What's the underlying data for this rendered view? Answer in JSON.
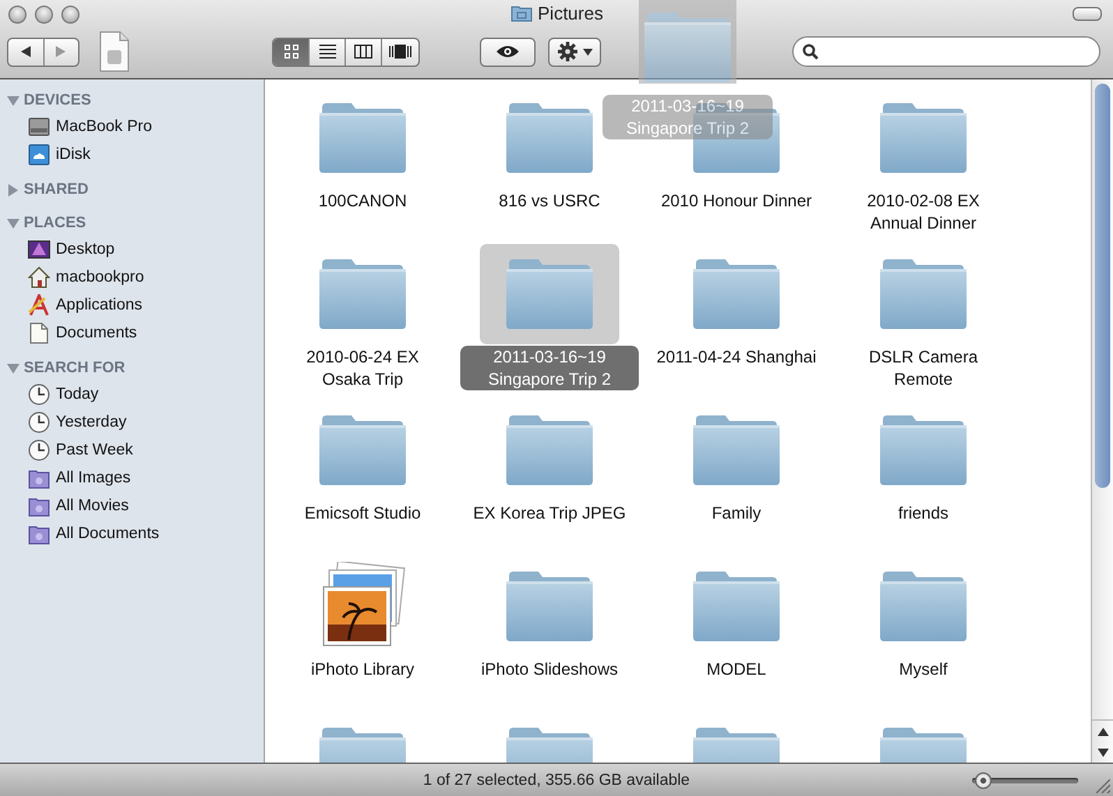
{
  "window": {
    "title": "Pictures"
  },
  "toolbar": {
    "view_modes": [
      {
        "kind": "icon",
        "selected": true
      },
      {
        "kind": "list",
        "selected": false
      },
      {
        "kind": "column",
        "selected": false
      },
      {
        "kind": "coverflow",
        "selected": false
      }
    ]
  },
  "sidebar": {
    "sections": [
      {
        "title": "DEVICES",
        "expanded": true,
        "items": [
          {
            "label": "MacBook Pro",
            "kind": "drive"
          },
          {
            "label": "iDisk",
            "kind": "idisk"
          }
        ]
      },
      {
        "title": "SHARED",
        "expanded": false
      },
      {
        "title": "PLACES",
        "expanded": true,
        "items": [
          {
            "label": "Desktop",
            "kind": "desktop"
          },
          {
            "label": "macbookpro",
            "kind": "home"
          },
          {
            "label": "Applications",
            "kind": "applications"
          },
          {
            "label": "Documents",
            "kind": "document"
          }
        ]
      },
      {
        "title": "SEARCH FOR",
        "expanded": true,
        "items": [
          {
            "label": "Today",
            "kind": "clock"
          },
          {
            "label": "Yesterday",
            "kind": "clock"
          },
          {
            "label": "Past Week",
            "kind": "clock"
          },
          {
            "label": "All Images",
            "kind": "smart"
          },
          {
            "label": "All Movies",
            "kind": "smart"
          },
          {
            "label": "All Documents",
            "kind": "smart"
          }
        ]
      }
    ]
  },
  "items": [
    {
      "name": "100CANON",
      "kind": "folder",
      "selected": false
    },
    {
      "name": "816 vs USRC",
      "kind": "folder",
      "selected": false
    },
    {
      "name": "2010 Honour Dinner",
      "kind": "folder",
      "selected": false
    },
    {
      "name": "2010-02-08 EX Annual Dinner",
      "kind": "folder",
      "selected": false
    },
    {
      "name": "2010-06-24 EX Osaka Trip",
      "kind": "folder",
      "selected": false
    },
    {
      "name": "2011-03-16~19 Singapore Trip 2",
      "kind": "folder",
      "selected": true
    },
    {
      "name": "2011-04-24 Shanghai",
      "kind": "folder",
      "selected": false
    },
    {
      "name": "DSLR Camera Remote",
      "kind": "folder",
      "selected": false
    },
    {
      "name": "Emicsoft Studio",
      "kind": "folder",
      "selected": false
    },
    {
      "name": "EX Korea Trip JPEG",
      "kind": "folder",
      "selected": false
    },
    {
      "name": "Family",
      "kind": "folder",
      "selected": false
    },
    {
      "name": "friends",
      "kind": "folder",
      "selected": false
    },
    {
      "name": "iPhoto Library",
      "kind": "photos",
      "selected": false
    },
    {
      "name": "iPhoto Slideshows",
      "kind": "folder",
      "selected": false
    },
    {
      "name": "MODEL",
      "kind": "folder",
      "selected": false
    },
    {
      "name": "Myself",
      "kind": "folder",
      "selected": false
    },
    {
      "kind": "folder"
    },
    {
      "kind": "folder"
    },
    {
      "kind": "folder"
    },
    {
      "kind": "folder"
    }
  ],
  "drag_ghost": {
    "label": "2011-03-16~19 Singapore Trip 2"
  },
  "status_bar": {
    "text": "1 of 27 selected, 355.66 GB available",
    "zoom_level": {
      "level": 0.1
    }
  }
}
